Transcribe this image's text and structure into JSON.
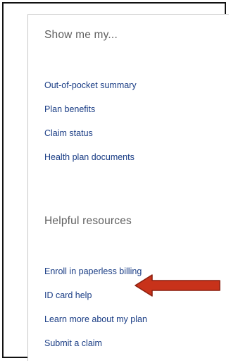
{
  "sections": [
    {
      "heading": "Show me my...",
      "links": [
        "Out-of-pocket summary",
        "Plan benefits",
        "Claim status",
        "Health plan documents"
      ]
    },
    {
      "heading": "Helpful resources",
      "links": [
        "Enroll in paperless billing",
        "ID card help",
        "Learn more about my plan",
        "Submit a claim"
      ]
    }
  ],
  "colors": {
    "heading": "#5f5f5f",
    "link": "#1a3d85",
    "arrow_fill": "#c8321a",
    "arrow_stroke": "#8a1f0f"
  },
  "annotation": {
    "type": "arrow",
    "points_to": "ID card help",
    "direction": "left"
  }
}
